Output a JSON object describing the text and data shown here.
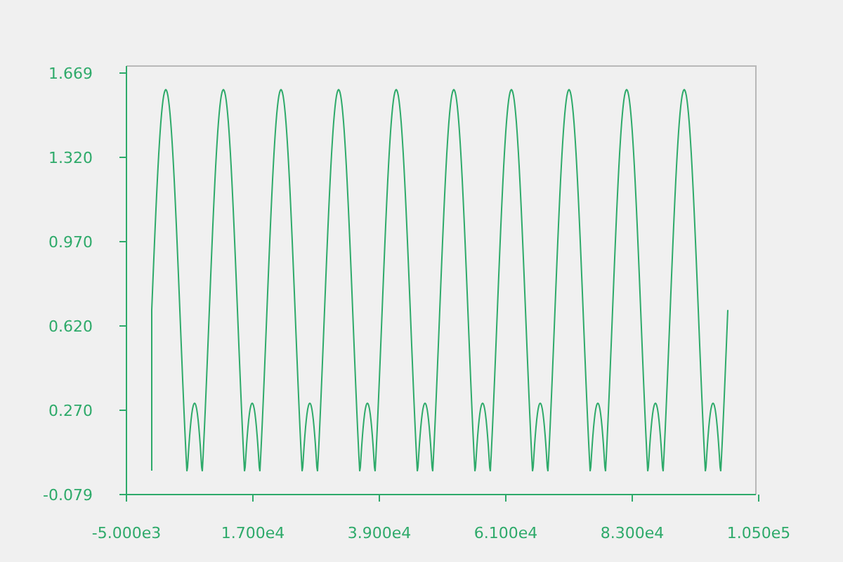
{
  "plot": {
    "y_tick_labels": [
      "1.669",
      "1.320",
      "0.970",
      "0.620",
      "0.270",
      "-0.079"
    ],
    "x_tick_labels": [
      "-5.000e3",
      "1.700e4",
      "3.900e4",
      "6.100e4",
      "8.300e4",
      "1.050e5"
    ]
  }
}
